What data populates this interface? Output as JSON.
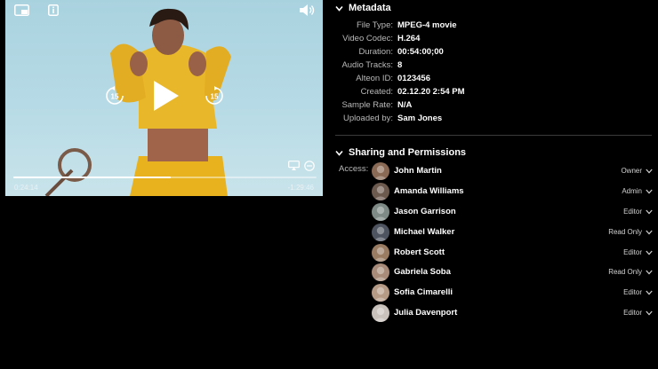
{
  "player": {
    "current_time": "0:24:14",
    "remaining_time": "-1:29:46",
    "progress": 0.52,
    "icons": {
      "pip": "picture-in-picture-icon",
      "info": "info-icon",
      "volume": "speaker-icon",
      "skip_back": "skip-back-15-icon",
      "play": "play-icon",
      "skip_forward": "skip-forward-15-icon",
      "airplay": "airplay-icon",
      "speed": "playback-speed-icon"
    },
    "skip_back_label": "15",
    "skip_forward_label": "15"
  },
  "metadata": {
    "title": "Metadata",
    "rows": [
      {
        "key": "File Type:",
        "value": "MPEG-4 movie"
      },
      {
        "key": "Video Codec:",
        "value": "H.264"
      },
      {
        "key": "Duration:",
        "value": "00:54:00;00"
      },
      {
        "key": "Audio Tracks:",
        "value": "8"
      },
      {
        "key": "Alteon ID:",
        "value": "0123456"
      },
      {
        "key": "Created:",
        "value": "02.12.20 2:54 PM"
      },
      {
        "key": "Sample Rate:",
        "value": "N/A"
      },
      {
        "key": "Uploaded by:",
        "value": "Sam Jones"
      }
    ]
  },
  "sharing": {
    "title": "Sharing and Permissions",
    "access_label": "Access:",
    "users": [
      {
        "name": "John Martin",
        "role": "Owner",
        "avatar_color": "#8a6a55"
      },
      {
        "name": "Amanda Williams",
        "role": "Admin",
        "avatar_color": "#6d5a4f"
      },
      {
        "name": "Jason Garrison",
        "role": "Editor",
        "avatar_color": "#7e8a86"
      },
      {
        "name": "Michael Walker",
        "role": "Read Only",
        "avatar_color": "#4f5560"
      },
      {
        "name": "Robert Scott",
        "role": "Editor",
        "avatar_color": "#9a7c63"
      },
      {
        "name": "Gabriela Soba",
        "role": "Read Only",
        "avatar_color": "#a88c79"
      },
      {
        "name": "Sofia Cimarelli",
        "role": "Editor",
        "avatar_color": "#b59a86"
      },
      {
        "name": "Julia Davenport",
        "role": "Editor",
        "avatar_color": "#c9c2bc"
      }
    ]
  }
}
